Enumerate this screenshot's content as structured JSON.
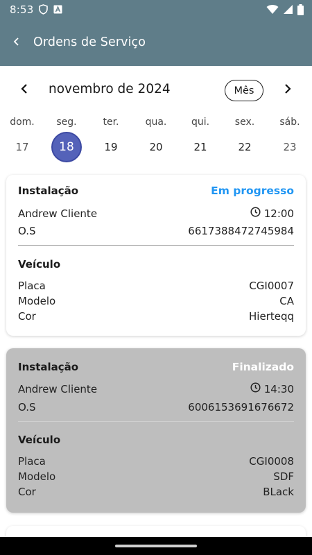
{
  "status_bar": {
    "time": "8:53"
  },
  "app_bar": {
    "title": "Ordens de Serviço"
  },
  "calendar": {
    "month_label": "novembro de 2024",
    "view_button": "Mês",
    "days": [
      {
        "name": "dom.",
        "num": "17"
      },
      {
        "name": "seg.",
        "num": "18",
        "selected": true
      },
      {
        "name": "ter.",
        "num": "19"
      },
      {
        "name": "qua.",
        "num": "20"
      },
      {
        "name": "qui.",
        "num": "21"
      },
      {
        "name": "sex.",
        "num": "22"
      },
      {
        "name": "sáb.",
        "num": "23"
      }
    ]
  },
  "orders": [
    {
      "type": "Instalação",
      "status": "Em progresso",
      "client": "Andrew Cliente",
      "time": "12:00",
      "os_label": "O.S",
      "os_number": "6617388472745984",
      "vehicle_title": "Veículo",
      "plate_label": "Placa",
      "plate": "CGI0007",
      "model_label": "Modelo",
      "model": "CA",
      "color_label": "Cor",
      "color": "Hierteqq"
    },
    {
      "type": "Instalação",
      "status": "Finalizado",
      "client": "Andrew Cliente",
      "time": "14:30",
      "os_label": "O.S",
      "os_number": "6006153691676672",
      "vehicle_title": "Veículo",
      "plate_label": "Placa",
      "plate": "CGI0008",
      "model_label": "Modelo",
      "model": "SDF",
      "color_label": "Cor",
      "color": "BLack"
    }
  ],
  "colors": {
    "app_bar": "#5f7d89",
    "selected_day": "#5462b9",
    "status_in_progress": "#2196f3",
    "finished_card": "#bebebe"
  }
}
